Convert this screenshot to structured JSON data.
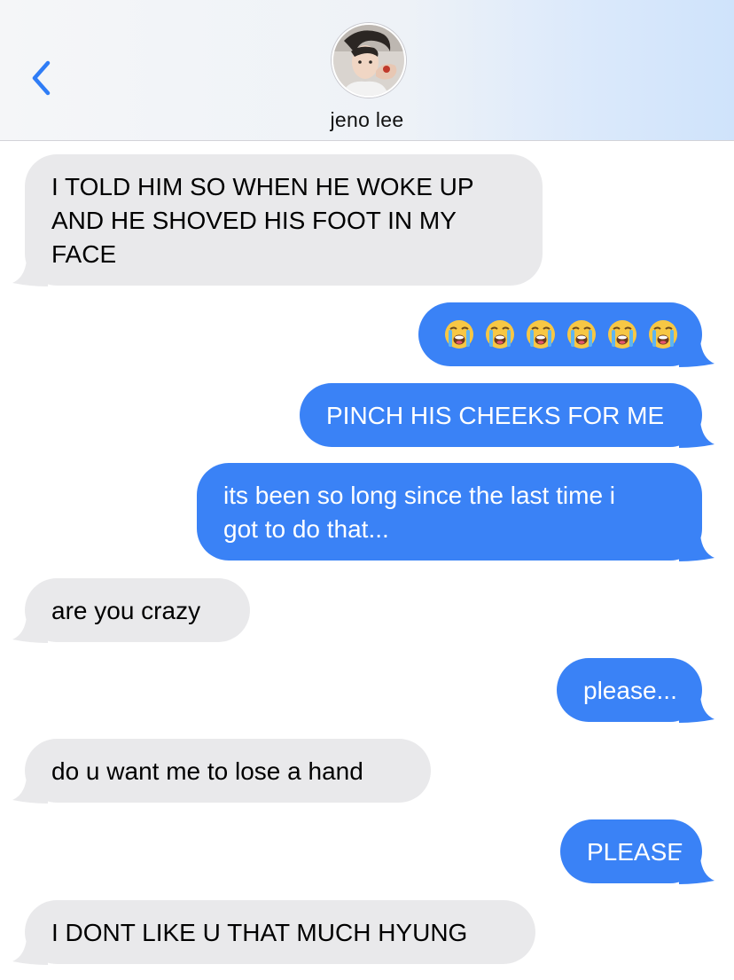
{
  "header": {
    "contact_name": "jeno lee",
    "back_icon": "chevron-left-icon",
    "avatar_icon": "contact-avatar"
  },
  "colors": {
    "sent_bubble": "#3a82f6",
    "received_bubble": "#e9e9eb",
    "accent": "#2f7df6"
  },
  "messages": [
    {
      "direction": "received",
      "lines": [
        "I TOLD HIM SO WHEN HE WOKE UP",
        "AND HE SHOVED HIS FOOT IN MY",
        "FACE"
      ]
    },
    {
      "direction": "sent",
      "emoji": "loudly-crying-face",
      "emoji_count": 6
    },
    {
      "direction": "sent",
      "text": "PINCH HIS CHEEKS FOR ME"
    },
    {
      "direction": "sent",
      "lines": [
        "its been so long since the last time i",
        "got to do that..."
      ]
    },
    {
      "direction": "received",
      "text": "are you crazy"
    },
    {
      "direction": "sent",
      "text": "please..."
    },
    {
      "direction": "received",
      "text": "do u want me to lose a hand"
    },
    {
      "direction": "sent",
      "text": "PLEASE"
    },
    {
      "direction": "received",
      "text": "I DONT LIKE U THAT MUCH HYUNG"
    }
  ]
}
